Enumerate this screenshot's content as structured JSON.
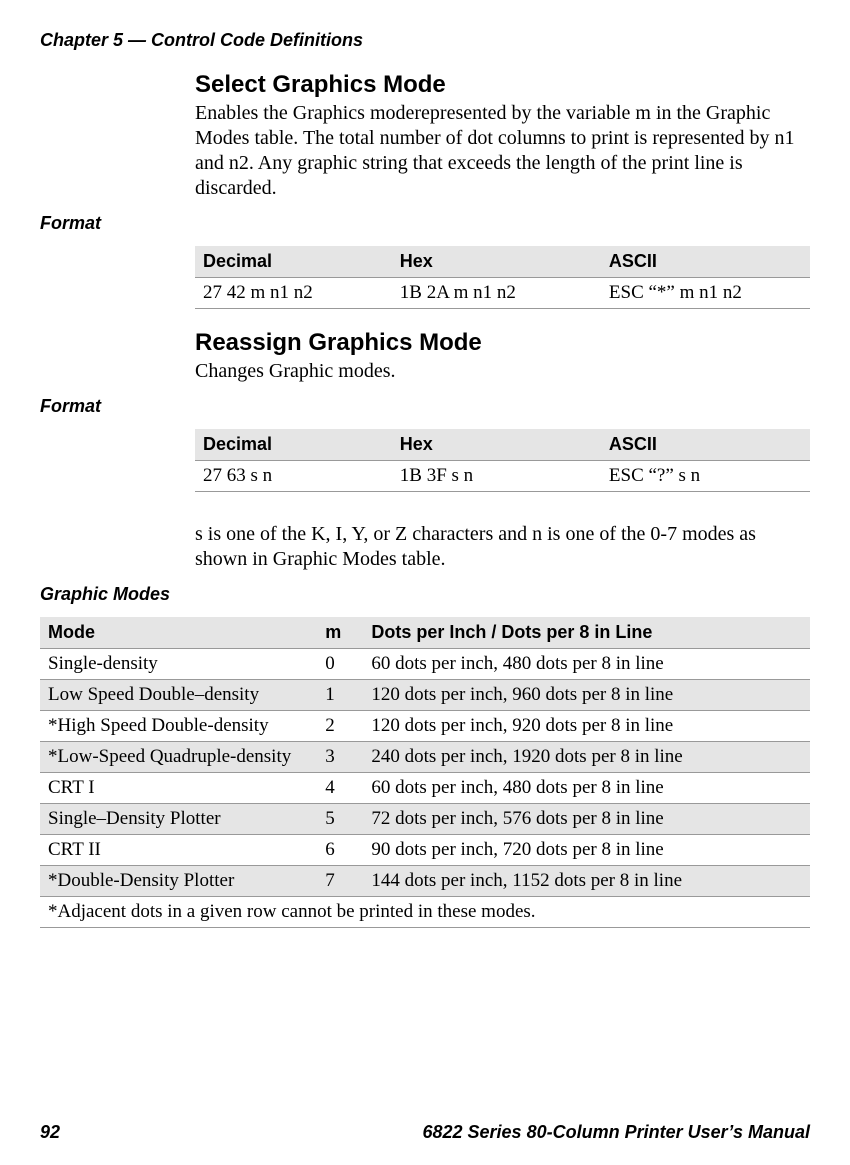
{
  "chapter_header": "Chapter 5 — Control Code Definitions",
  "section1": {
    "title": "Select Graphics Mode",
    "desc": "Enables the Graphics moderepresented by the variable m in the Graphic Modes table. The total number of dot columns to print is represented by n1 and n2. Any graphic string that exceeds the length of the print line is discarded."
  },
  "format_label": "Format",
  "table1": {
    "h1": "Decimal",
    "h2": "Hex",
    "h3": "ASCII",
    "r1c1": "27 42 m n1 n2",
    "r1c2": "1B 2A m n1 n2",
    "r1c3": "ESC “*” m n1 n2"
  },
  "section2": {
    "title": "Reassign Graphics Mode",
    "desc": "Changes Graphic modes."
  },
  "table2": {
    "h1": "Decimal",
    "h2": "Hex",
    "h3": "ASCII",
    "r1c1": "27 63 s n",
    "r1c2": "1B 3F s n",
    "r1c3": "ESC “?” s n"
  },
  "post_table2_text": "s is one of the K, I, Y, or Z characters and n is one of the 0-7 modes as shown in Graphic Modes table.",
  "modes_label": "Graphic Modes",
  "modes_table": {
    "h1": "Mode",
    "h2": "m",
    "h3": "Dots per Inch / Dots per 8 in Line",
    "rows": [
      {
        "mode": "Single-density",
        "m": "0",
        "desc": "60 dots per inch, 480 dots per 8 in line"
      },
      {
        "mode": "Low Speed Double–density",
        "m": "1",
        "desc": "120 dots per inch, 960 dots per 8 in line"
      },
      {
        "mode": "*High Speed Double-density",
        "m": "2",
        "desc": "120 dots per inch, 920 dots per 8 in line"
      },
      {
        "mode": "*Low-Speed Quadruple-density",
        "m": "3",
        "desc": "240 dots per inch, 1920 dots per 8 in line"
      },
      {
        "mode": "CRT I",
        "m": "4",
        "desc": "60 dots per inch, 480 dots per 8 in line"
      },
      {
        "mode": "Single–Density Plotter",
        "m": "5",
        "desc": "72 dots per inch, 576 dots per 8 in line"
      },
      {
        "mode": "CRT II",
        "m": "6",
        "desc": "90 dots per inch, 720 dots per 8 in line"
      },
      {
        "mode": "*Double-Density Plotter",
        "m": "7",
        "desc": "144 dots per inch, 1152 dots per 8 in line"
      }
    ],
    "footnote": "*Adjacent dots in a given row cannot be printed in these modes."
  },
  "footer": {
    "page": "92",
    "manual": "6822 Series 80-Column Printer User’s Manual"
  }
}
